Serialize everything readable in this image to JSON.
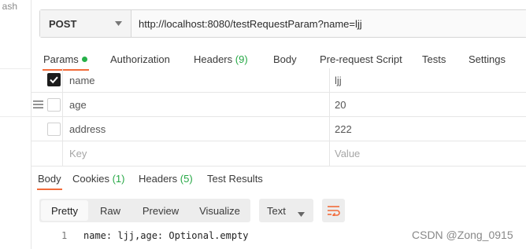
{
  "sidebar": {
    "fragment_text": "ash"
  },
  "request": {
    "method": "POST",
    "url": "http://localhost:8080/testRequestParam?name=ljj"
  },
  "request_tabs": [
    {
      "label": "Params",
      "active": true,
      "has_dot": true
    },
    {
      "label": "Authorization"
    },
    {
      "label": "Headers",
      "count": "(9)"
    },
    {
      "label": "Body"
    },
    {
      "label": "Pre-request Script"
    },
    {
      "label": "Tests"
    },
    {
      "label": "Settings"
    }
  ],
  "params": {
    "rows": [
      {
        "key": "name",
        "value": "ljj",
        "checked": true
      },
      {
        "key": "age",
        "value": "20",
        "checked": false
      },
      {
        "key": "address",
        "value": "222",
        "checked": false
      }
    ],
    "placeholder_key": "Key",
    "placeholder_value": "Value"
  },
  "response_tabs": [
    {
      "label": "Body",
      "active": true
    },
    {
      "label": "Cookies",
      "count": "(1)"
    },
    {
      "label": "Headers",
      "count": "(5)"
    },
    {
      "label": "Test Results"
    }
  ],
  "response_view": {
    "modes": [
      "Pretty",
      "Raw",
      "Preview",
      "Visualize"
    ],
    "active_mode": "Pretty",
    "format": "Text"
  },
  "response_body": {
    "line_number": "1",
    "text": "name: ljj,age: Optional.empty"
  },
  "watermark": "CSDN @Zong_0915",
  "colors": {
    "accent": "#f26b3a",
    "count_green": "#26a845",
    "wrap_icon": "#f26b3a"
  }
}
